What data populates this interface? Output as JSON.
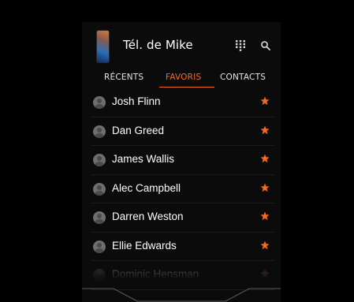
{
  "header": {
    "device_name": "Tél. de Mike",
    "dialpad_icon": "dialpad-icon",
    "search_icon": "search-icon"
  },
  "tabs": [
    {
      "label": "RÉCENTS",
      "active": false
    },
    {
      "label": "FAVORIS",
      "active": true
    },
    {
      "label": "CONTACTS",
      "active": false
    }
  ],
  "favorites": [
    {
      "name": "Josh Flinn"
    },
    {
      "name": "Dan Greed"
    },
    {
      "name": "James Wallis"
    },
    {
      "name": "Alec Campbell"
    },
    {
      "name": "Darren Weston"
    },
    {
      "name": "Ellie Edwards"
    },
    {
      "name": "Dominic Hensman"
    }
  ],
  "colors": {
    "accent": "#f26a22",
    "background": "#000000",
    "text": "#ffffff"
  }
}
